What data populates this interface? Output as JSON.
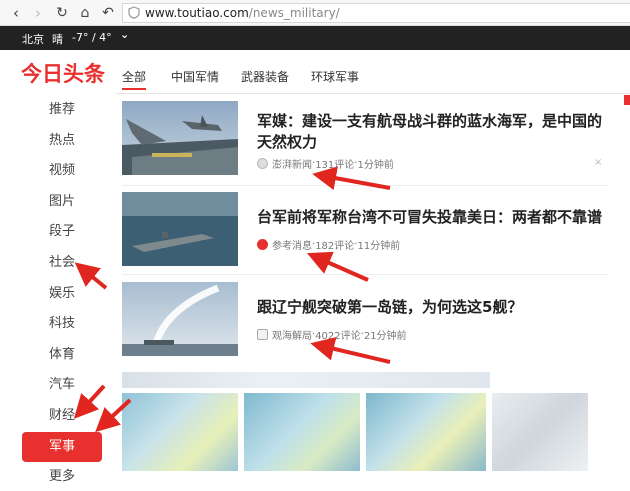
{
  "browser": {
    "url_domain": "www.toutiao.com",
    "url_path": "/news_military/"
  },
  "weather": {
    "city": "北京",
    "condition": "晴",
    "temp": "-7° / 4°",
    "dropdown": "⌄"
  },
  "logo": "今日头条",
  "sidebar": {
    "items": [
      {
        "label": "推荐"
      },
      {
        "label": "热点"
      },
      {
        "label": "视频"
      },
      {
        "label": "图片"
      },
      {
        "label": "段子"
      },
      {
        "label": "社会"
      },
      {
        "label": "娱乐"
      },
      {
        "label": "科技"
      },
      {
        "label": "体育"
      },
      {
        "label": "汽车"
      },
      {
        "label": "财经"
      },
      {
        "label": "军事",
        "active": true
      },
      {
        "label": "更多"
      }
    ]
  },
  "tabs": [
    {
      "label": "全部",
      "active": true
    },
    {
      "label": "中国军情"
    },
    {
      "label": "武器装备"
    },
    {
      "label": "环球军事"
    }
  ],
  "news": [
    {
      "title": "军媒：建设一支有航母战斗群的蓝水海军，是中国的天然权力",
      "source": "澎湃新闻",
      "comments": "131评论",
      "time": "1分钟前"
    },
    {
      "title": "台军前将军称台湾不可冒失投靠美日：两者都不靠谱",
      "source": "参考消息",
      "comments": "182评论",
      "time": "11分钟前"
    },
    {
      "title": "跟辽宁舰突破第一岛链，为何选这5舰？",
      "source": "观海解局",
      "comments": "4022评论",
      "time": "21分钟前"
    }
  ],
  "meta_separator": " · ",
  "close_glyph": "×",
  "icons": {
    "back": "chevron-left-icon",
    "forward": "chevron-right-icon",
    "reload": "reload-icon",
    "home": "home-icon",
    "undo": "undo-icon",
    "shield": "shield-icon"
  },
  "colors": {
    "brand_red": "#e8312f",
    "annotation_red": "#e0261f"
  }
}
